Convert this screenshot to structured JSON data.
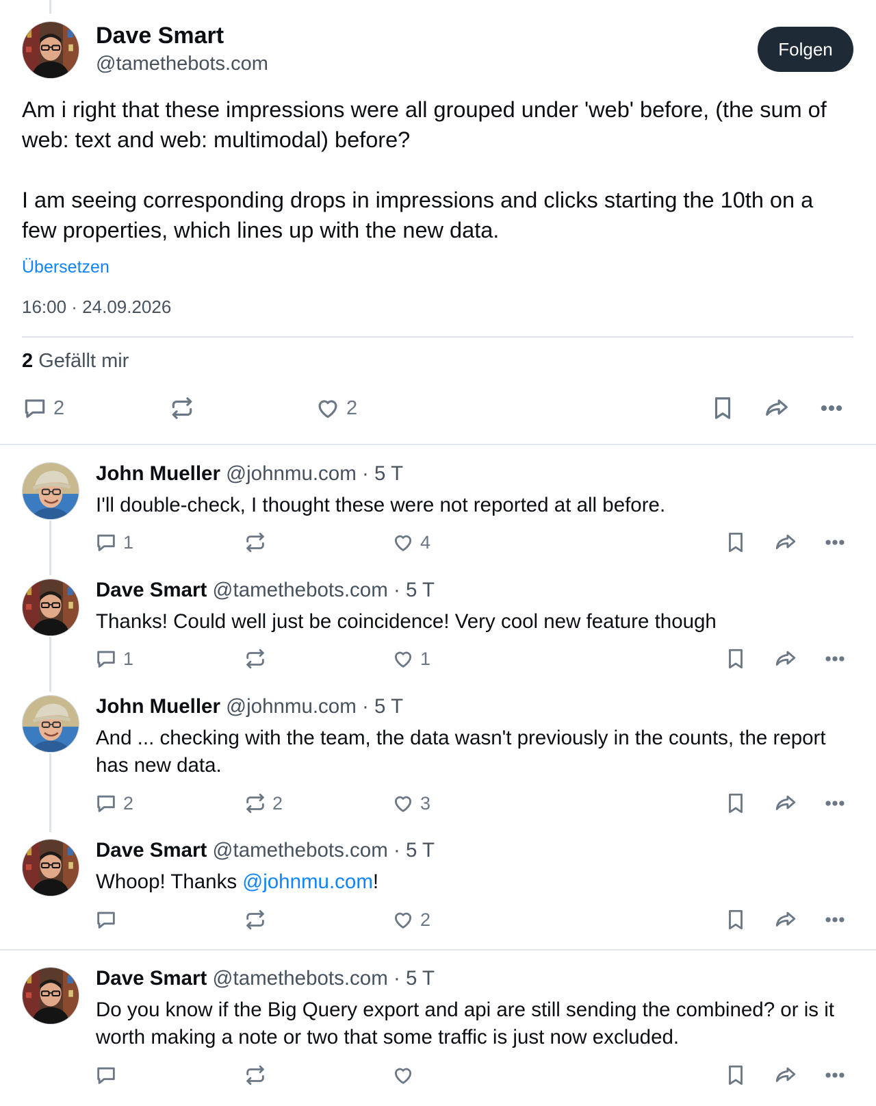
{
  "main_post": {
    "author_name": "Dave Smart",
    "author_handle": "@tamethebots.com",
    "follow_label": "Folgen",
    "text": "Am i right that these impressions were all grouped under 'web' before, (the sum of web: text and web: multimodal) before?\n\nI am seeing corresponding drops in impressions and clicks starting the 10th on a few properties, which lines up with the new data.",
    "translate_label": "Übersetzen",
    "timestamp": "16:00 · 24.09.2026",
    "likes_count": "2",
    "likes_label": "Gefällt mir",
    "stats": {
      "replies": "2",
      "reposts": "",
      "likes": "2"
    }
  },
  "replies": [
    {
      "author_name": "John Mueller",
      "meta": "@johnmu.com · 5 T",
      "text": "I'll double-check, I thought these were not reported at all before.",
      "stats": {
        "replies": "1",
        "reposts": "",
        "likes": "4"
      }
    },
    {
      "author_name": "Dave Smart",
      "meta": "@tamethebots.com · 5 T",
      "text": "Thanks! Could well just be coincidence! Very cool new feature though",
      "stats": {
        "replies": "1",
        "reposts": "",
        "likes": "1"
      }
    },
    {
      "author_name": "John Mueller",
      "meta": "@johnmu.com · 5 T",
      "text": "And ... checking with the team, the data wasn't previously in the counts, the report has new data.",
      "stats": {
        "replies": "2",
        "reposts": "2",
        "likes": "3"
      }
    },
    {
      "author_name": "Dave Smart",
      "meta": "@tamethebots.com · 5 T",
      "text_before": "Whoop! Thanks ",
      "mention": "@johnmu.com",
      "text_after": "!",
      "stats": {
        "replies": "",
        "reposts": "",
        "likes": "2"
      }
    },
    {
      "author_name": "Dave Smart",
      "meta": "@tamethebots.com · 5 T",
      "text": "Do you know if the Big Query export and api are still sending the combined? or is it worth making a note or two that some traffic is just now excluded.",
      "stats": {
        "replies": "",
        "reposts": "",
        "likes": ""
      }
    }
  ],
  "icons": {
    "reply": "speech-bubble-icon",
    "repost": "repost-arrows-icon",
    "like": "heart-icon",
    "bookmark": "bookmark-icon",
    "share": "share-arrow-icon",
    "more": "ellipsis-icon"
  },
  "colors": {
    "accent_link": "#1083fe",
    "follow_button": "#1f2a37",
    "muted_text": "#47525e",
    "icon_gray": "#6b7785"
  }
}
